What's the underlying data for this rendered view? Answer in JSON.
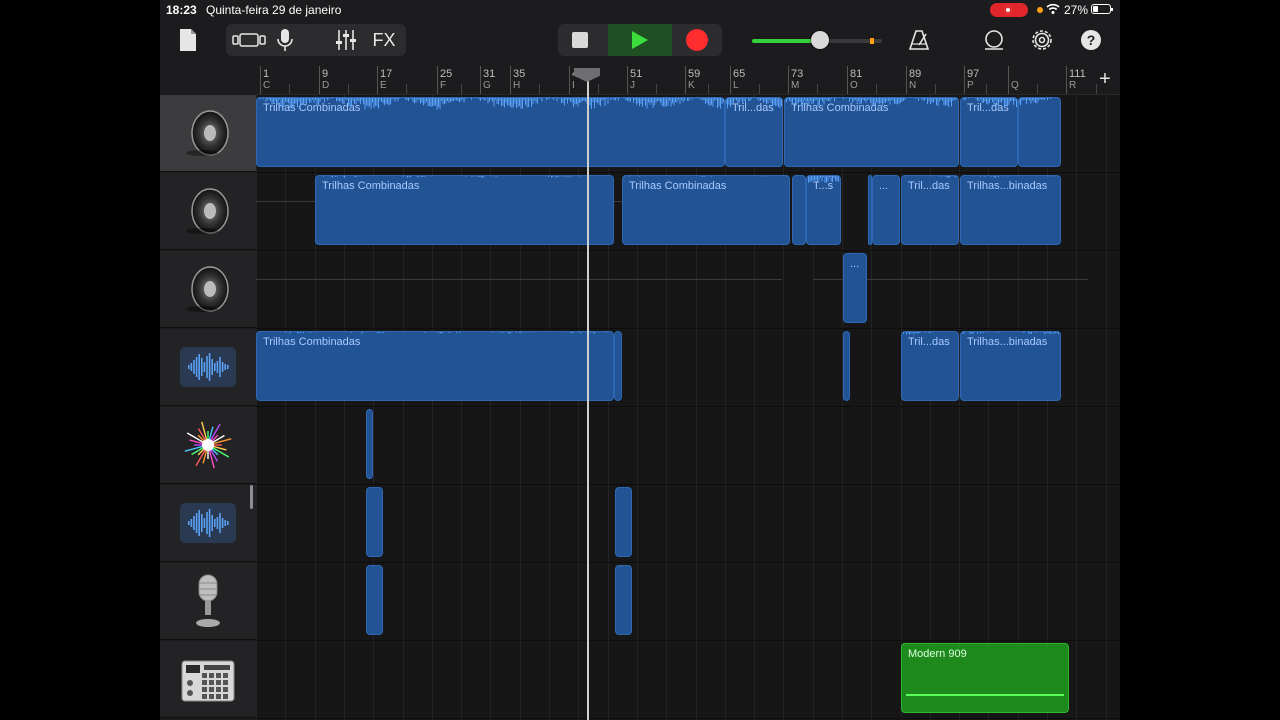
{
  "status_bar": {
    "time": "18:23",
    "date": "Quinta-feira 29 de janeiro",
    "battery": "27%"
  },
  "toolbar": {
    "fx_label": "FX"
  },
  "ruler": {
    "bars": [
      {
        "num": "1",
        "letter": "C"
      },
      {
        "num": "9",
        "letter": "D"
      },
      {
        "num": "17",
        "letter": "E"
      },
      {
        "num": "25",
        "letter": "F"
      },
      {
        "num": "31",
        "letter": "G"
      },
      {
        "num": "35",
        "letter": "H"
      },
      {
        "num": "43",
        "letter": "I"
      },
      {
        "num": "51",
        "letter": "J"
      },
      {
        "num": "59",
        "letter": "K"
      },
      {
        "num": "65",
        "letter": "L"
      },
      {
        "num": "73",
        "letter": "M"
      },
      {
        "num": "81",
        "letter": "O"
      },
      {
        "num": "89",
        "letter": "N"
      },
      {
        "num": "97",
        "letter": "P"
      },
      {
        "num": "",
        "letter": "Q"
      },
      {
        "num": "111",
        "letter": "R"
      }
    ]
  },
  "tracks": [
    {
      "icon": "speaker-icon",
      "selected": true
    },
    {
      "icon": "speaker-icon",
      "selected": false
    },
    {
      "icon": "speaker-icon",
      "selected": false
    },
    {
      "icon": "audio-recorder-icon",
      "selected": false
    },
    {
      "icon": "sparkle-synth-icon",
      "selected": false
    },
    {
      "icon": "audio-recorder-icon",
      "selected": false
    },
    {
      "icon": "microphone-icon",
      "selected": false
    },
    {
      "icon": "drum-machine-icon",
      "selected": false
    }
  ],
  "regions": {
    "t1": [
      "Trilhas Combinadas",
      "Tril...das",
      "Trilhas Combinadas",
      "Tril...das"
    ],
    "t2": [
      "Trilhas Combinadas",
      "Trilhas Combinadas",
      "T...s",
      "...",
      "Tril...das",
      "Trilhas...binadas"
    ],
    "t3": [
      "..."
    ],
    "t4": [
      "Trilhas Combinadas",
      "Tril...das",
      "Trilhas...binadas"
    ],
    "t8": [
      "Modern 909"
    ]
  },
  "colors": {
    "region_blue": "#215395",
    "waveform_blue": "#5aa0f5",
    "region_green": "#1e8a1e",
    "play_green": "#3ddc3d",
    "record_red": "#ff2d2d",
    "meter_orange": "#ff9f0a"
  },
  "master_volume": 0.52
}
